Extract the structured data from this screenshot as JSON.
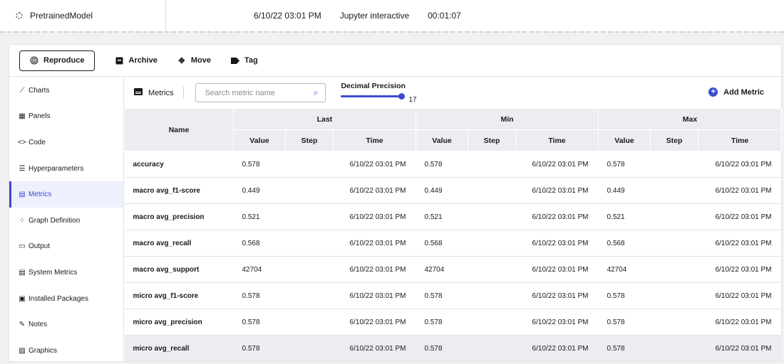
{
  "topbar": {
    "experiment_name": "PretrainedModel",
    "date": "6/10/22 03:01 PM",
    "type": "Jupyter interactive",
    "duration": "00:01:07"
  },
  "toolbar": {
    "reproduce": "Reproduce",
    "archive": "Archive",
    "move": "Move",
    "tag": "Tag"
  },
  "sidebar": {
    "items": [
      {
        "label": "Charts",
        "icon": "line-chart-icon"
      },
      {
        "label": "Panels",
        "icon": "grid-icon"
      },
      {
        "label": "Code",
        "icon": "code-icon"
      },
      {
        "label": "Hyperparameters",
        "icon": "list-icon"
      },
      {
        "label": "Metrics",
        "icon": "metrics-icon"
      },
      {
        "label": "Graph Definition",
        "icon": "graph-icon"
      },
      {
        "label": "Output",
        "icon": "monitor-icon"
      },
      {
        "label": "System Metrics",
        "icon": "system-icon"
      },
      {
        "label": "Installed Packages",
        "icon": "package-icon"
      },
      {
        "label": "Notes",
        "icon": "pencil-icon"
      },
      {
        "label": "Graphics",
        "icon": "image-icon"
      }
    ],
    "active": "Metrics"
  },
  "metrics_header": {
    "tab_label": "Metrics",
    "search_placeholder": "Search metric name",
    "precision_label": "Decimal Precision",
    "precision_value": "17",
    "add_metric": "Add Metric"
  },
  "table": {
    "name_header": "Name",
    "groups": [
      "Last",
      "Min",
      "Max"
    ],
    "subheaders": [
      "Value",
      "Step",
      "Time"
    ],
    "rows": [
      {
        "name": "accuracy",
        "last": "0.578",
        "last_time": "6/10/22 03:01 PM",
        "min": "0.578",
        "min_time": "6/10/22 03:01 PM",
        "max": "0.578",
        "max_time": "6/10/22 03:01 PM"
      },
      {
        "name": "macro avg_f1-score",
        "last": "0.449",
        "last_time": "6/10/22 03:01 PM",
        "min": "0.449",
        "min_time": "6/10/22 03:01 PM",
        "max": "0.449",
        "max_time": "6/10/22 03:01 PM"
      },
      {
        "name": "macro avg_precision",
        "last": "0.521",
        "last_time": "6/10/22 03:01 PM",
        "min": "0.521",
        "min_time": "6/10/22 03:01 PM",
        "max": "0.521",
        "max_time": "6/10/22 03:01 PM"
      },
      {
        "name": "macro avg_recall",
        "last": "0.568",
        "last_time": "6/10/22 03:01 PM",
        "min": "0.568",
        "min_time": "6/10/22 03:01 PM",
        "max": "0.568",
        "max_time": "6/10/22 03:01 PM"
      },
      {
        "name": "macro avg_support",
        "last": "42704",
        "last_time": "6/10/22 03:01 PM",
        "min": "42704",
        "min_time": "6/10/22 03:01 PM",
        "max": "42704",
        "max_time": "6/10/22 03:01 PM"
      },
      {
        "name": "micro avg_f1-score",
        "last": "0.578",
        "last_time": "6/10/22 03:01 PM",
        "min": "0.578",
        "min_time": "6/10/22 03:01 PM",
        "max": "0.578",
        "max_time": "6/10/22 03:01 PM"
      },
      {
        "name": "micro avg_precision",
        "last": "0.578",
        "last_time": "6/10/22 03:01 PM",
        "min": "0.578",
        "min_time": "6/10/22 03:01 PM",
        "max": "0.578",
        "max_time": "6/10/22 03:01 PM"
      },
      {
        "name": "micro avg_recall",
        "last": "0.578",
        "last_time": "6/10/22 03:01 PM",
        "min": "0.578",
        "min_time": "6/10/22 03:01 PM",
        "max": "0.578",
        "max_time": "6/10/22 03:01 PM"
      }
    ]
  },
  "colors": {
    "accent": "#3c4bd1",
    "header_bg": "#ededf1"
  }
}
